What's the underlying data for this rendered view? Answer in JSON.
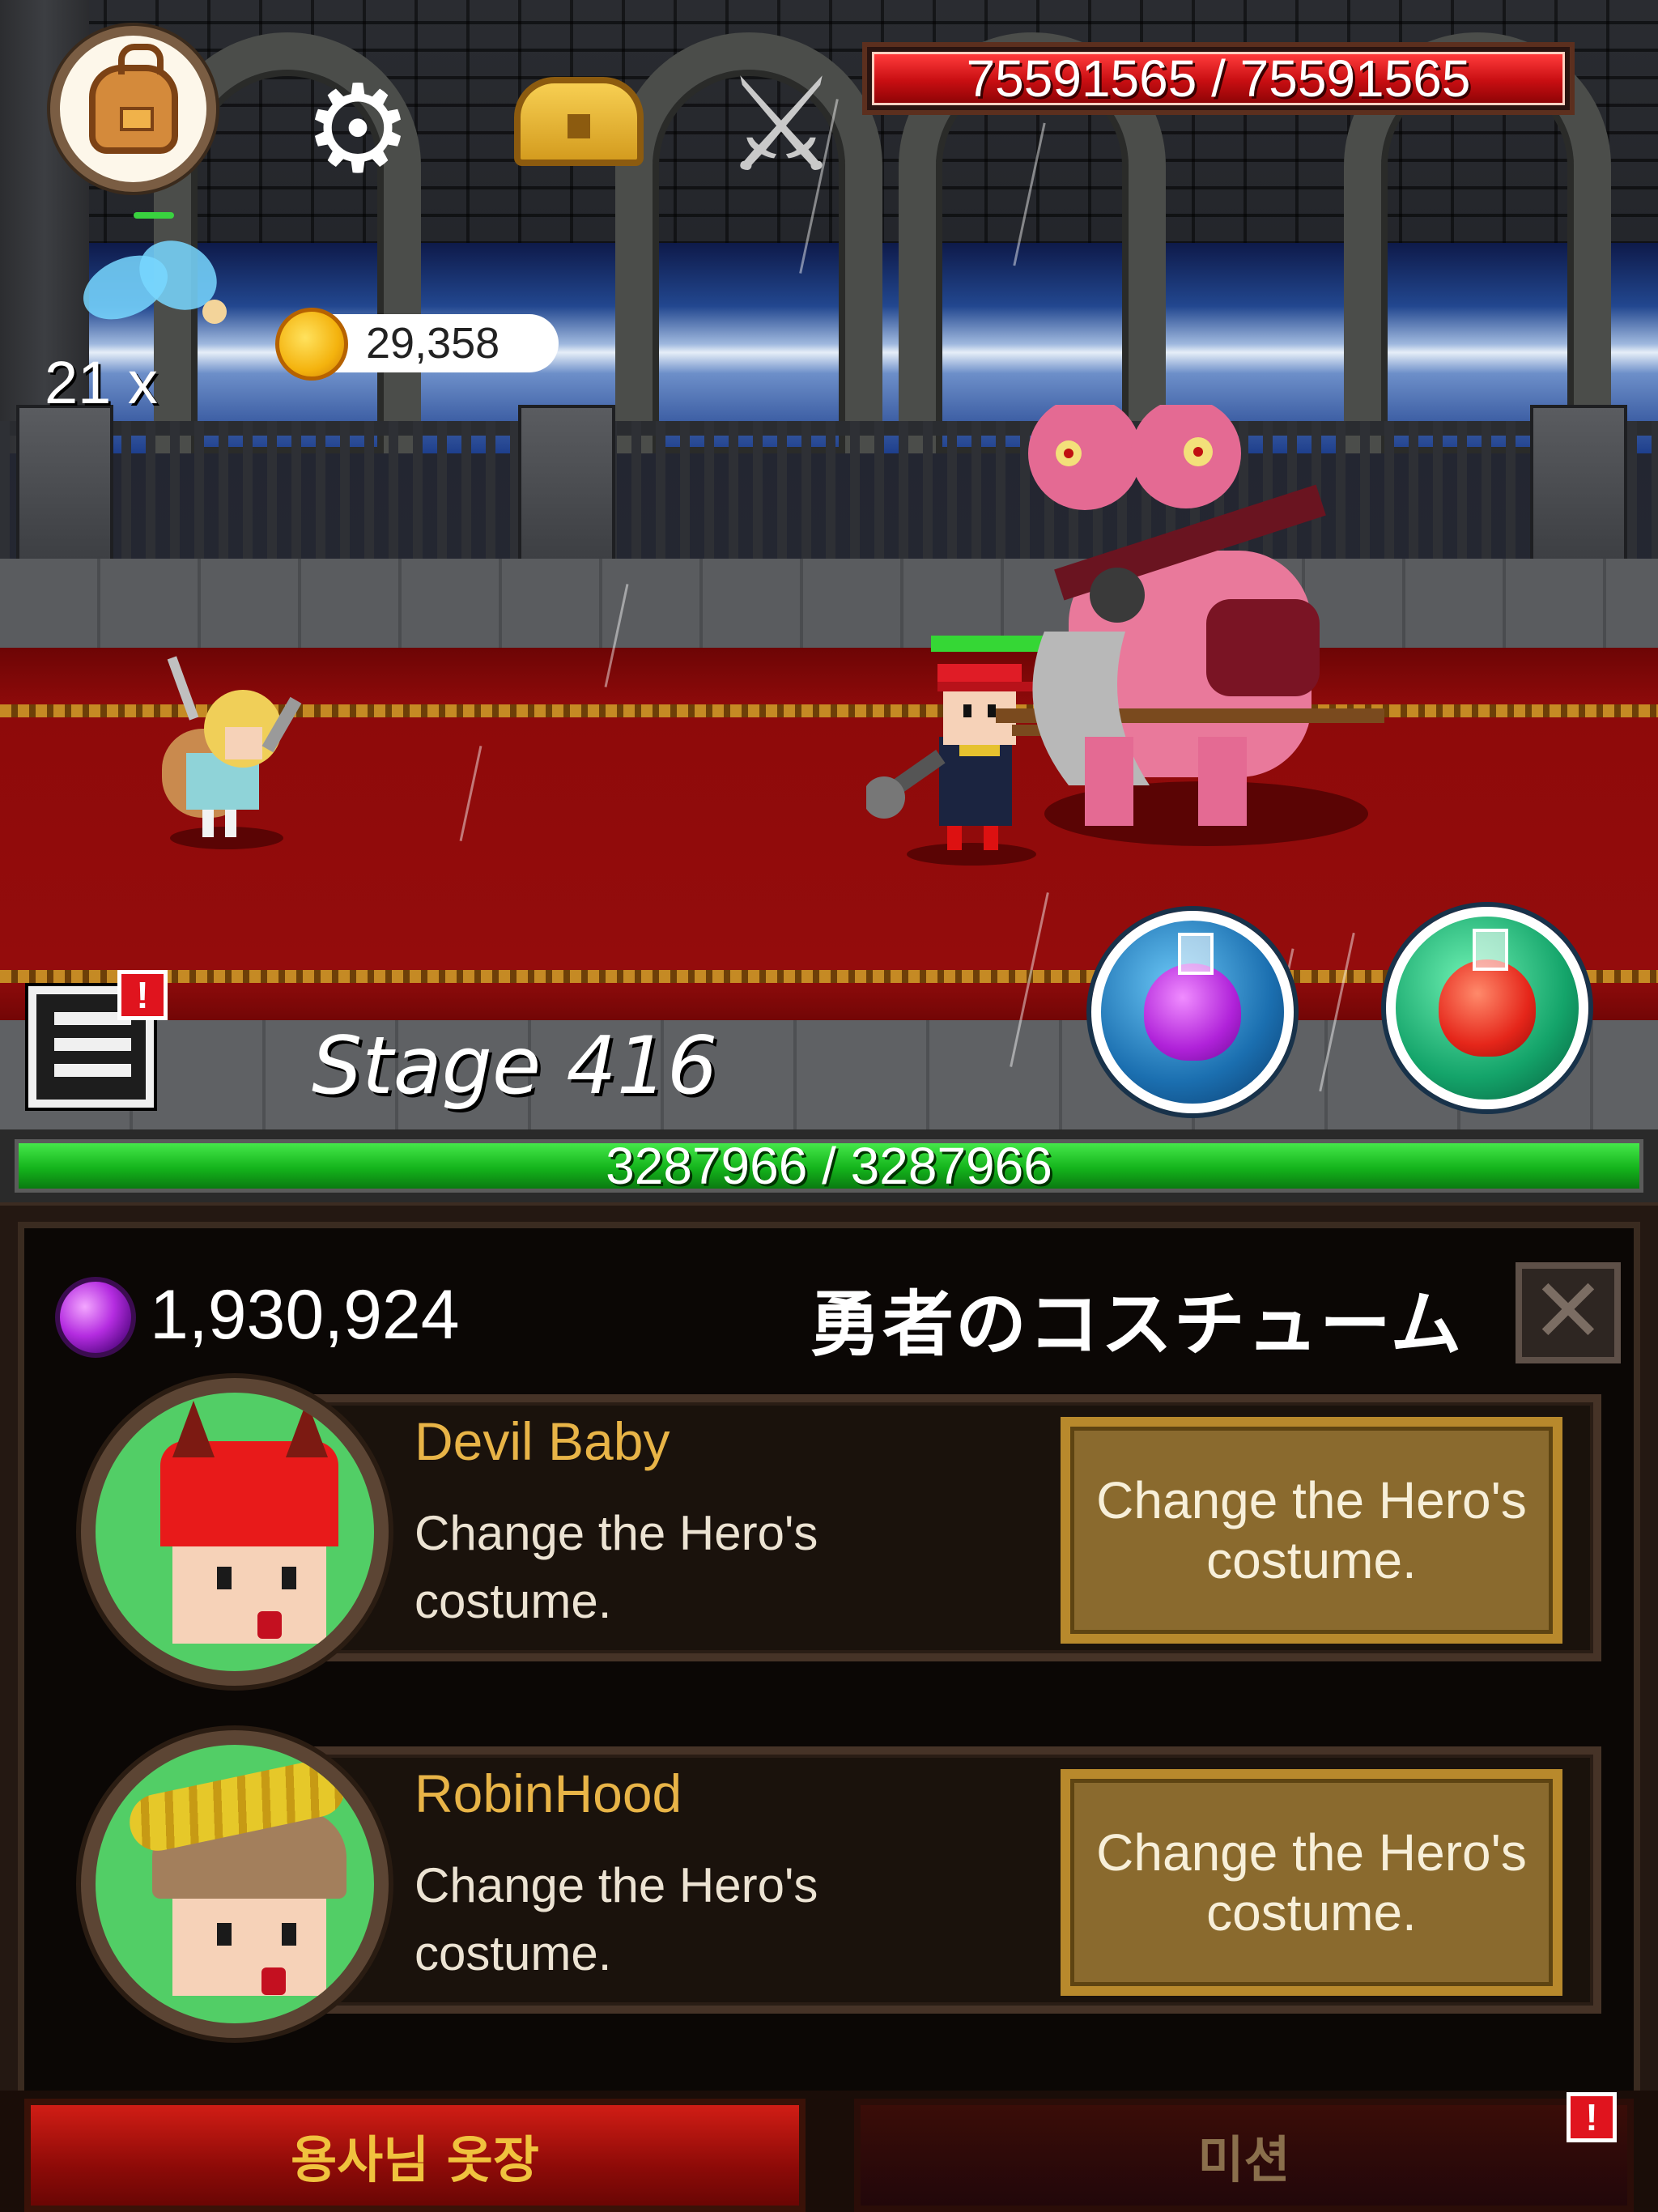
{
  "hud": {
    "boss_hp_text": "75591565 / 75591565",
    "boss_hp_fraction": 1.0,
    "fairy_count": "21 x",
    "gold_amount": "29,358",
    "stage_label": "Stage 416",
    "quest_alert": "!",
    "icons": {
      "bag": "backpack-icon",
      "settings": "gear-icon",
      "chest": "treasure-chest-icon",
      "battle": "crossed-swords-icon"
    }
  },
  "player": {
    "hp_text": "3287966 / 3287966",
    "hp_fraction": 1.0
  },
  "panel": {
    "gem_amount": "1,930,924",
    "title": "勇者のコスチューム",
    "close_label": "✕",
    "costumes": [
      {
        "name": "Devil Baby",
        "description": "Change the Hero's costume.",
        "action_label": "Change the Hero's costume."
      },
      {
        "name": "RobinHood",
        "description": "Change the Hero's costume.",
        "action_label": "Change the Hero's costume."
      }
    ]
  },
  "tabs": {
    "wardrobe": "용사님 옷장",
    "mission": "미션",
    "mission_alert": "!"
  },
  "colors": {
    "boss_hp": "#c80e12",
    "player_hp": "#14b41c",
    "costume_name": "#e8b447",
    "button_gold": "#8a6a2e",
    "tab_active": "#d11d15"
  }
}
